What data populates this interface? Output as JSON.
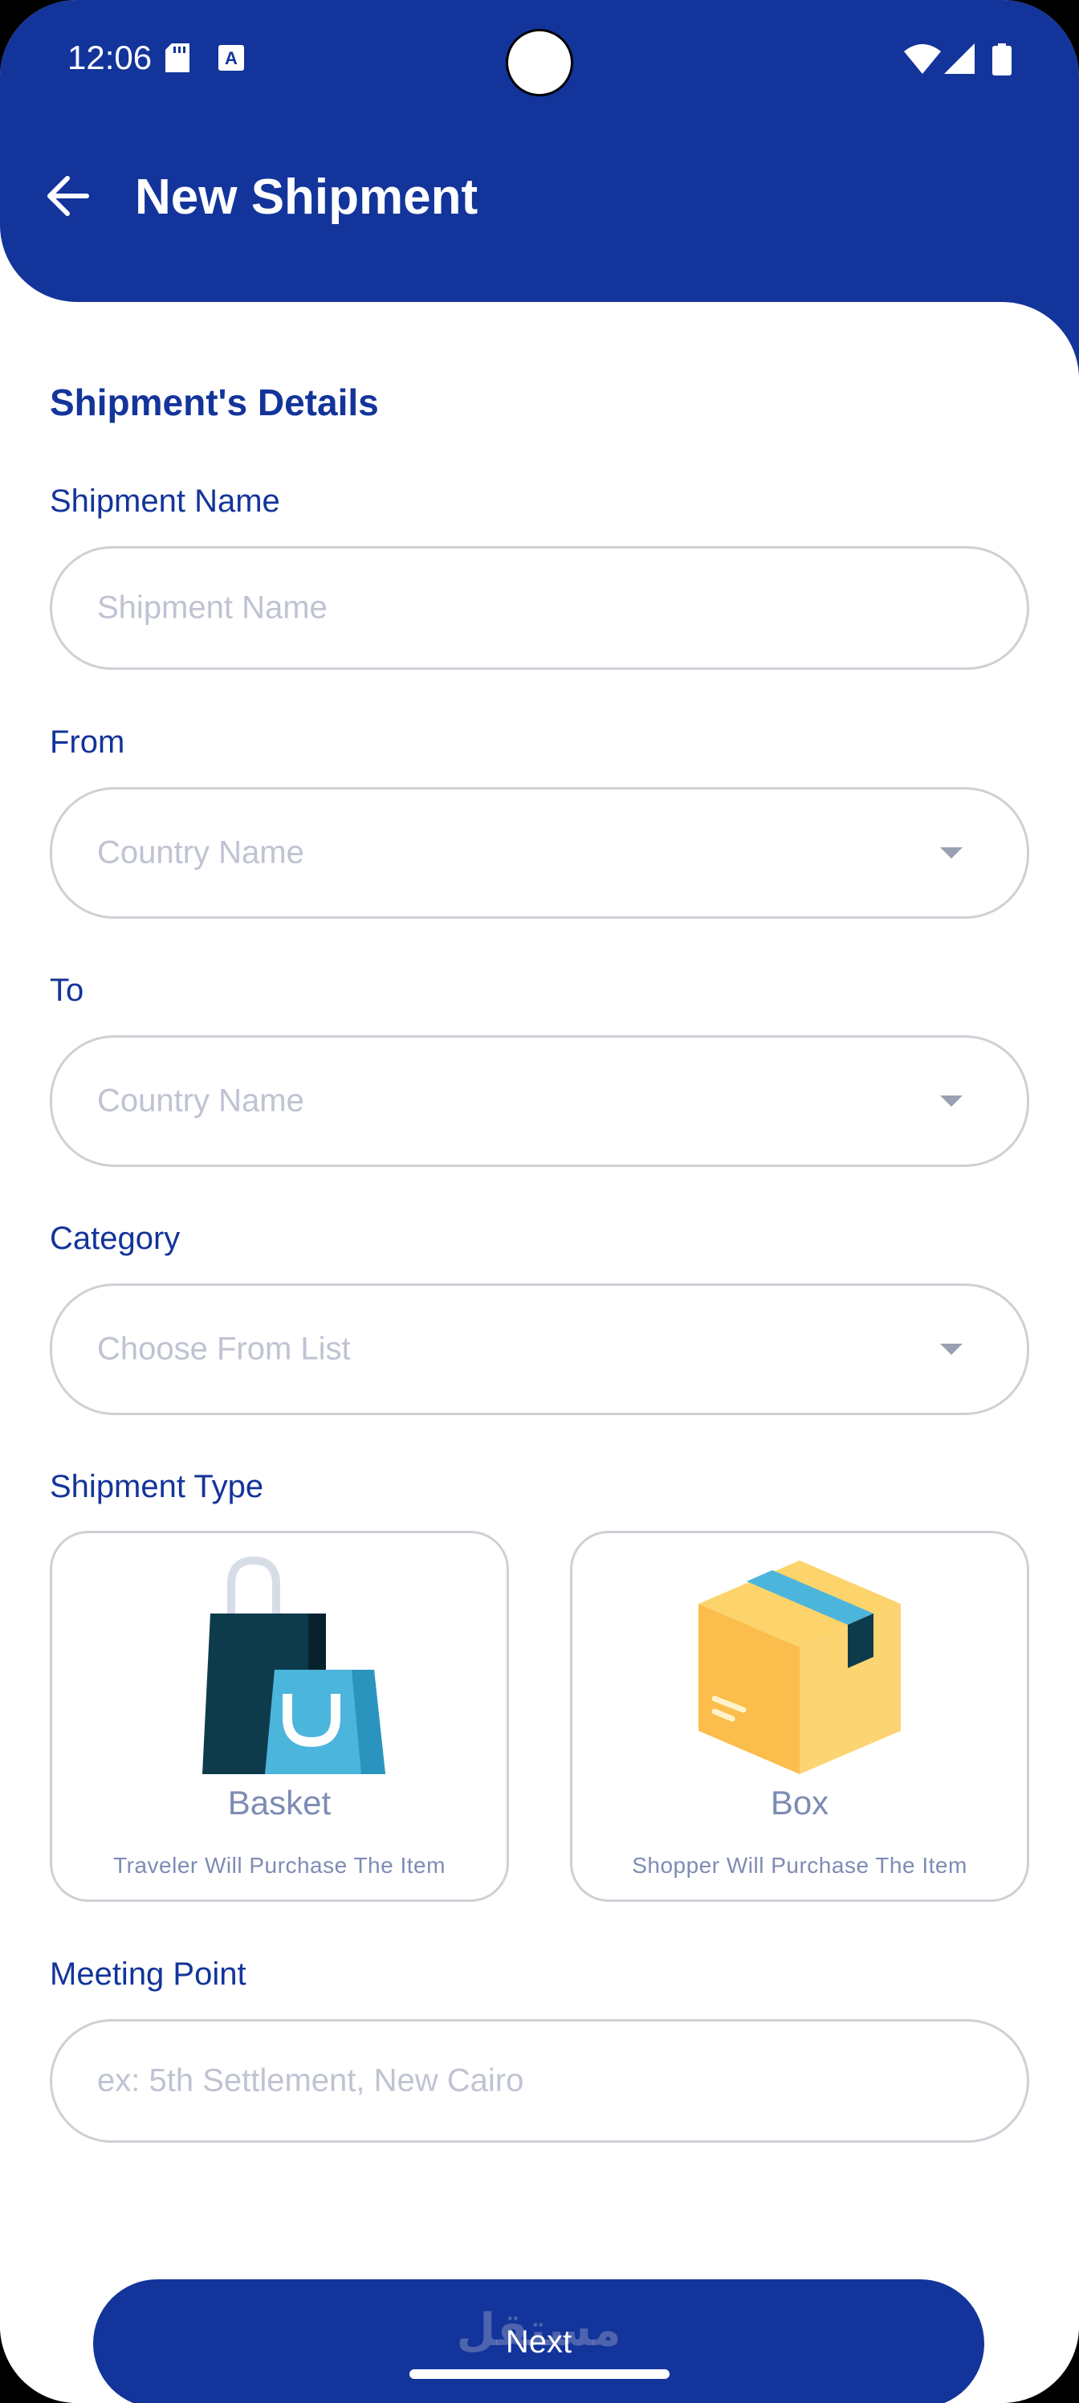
{
  "status_bar": {
    "time": "12:06",
    "left_icons": [
      "sd-card-icon",
      "text-a-icon"
    ],
    "right_icons": [
      "wifi-icon",
      "cell-signal-icon",
      "battery-icon"
    ]
  },
  "header": {
    "title": "New Shipment",
    "back_icon": "arrow-left-icon"
  },
  "form": {
    "section_title": "Shipment's Details",
    "shipment_name": {
      "label": "Shipment Name",
      "placeholder": "Shipment Name"
    },
    "from": {
      "label": "From",
      "placeholder": "Country Name"
    },
    "to": {
      "label": "To",
      "placeholder": "Country Name"
    },
    "category": {
      "label": "Category",
      "placeholder": "Choose From List"
    },
    "shipment_type": {
      "label": "Shipment Type",
      "options": [
        {
          "name": "Basket",
          "description": "Traveler Will Purchase The Item",
          "icon": "shopping-bags-icon"
        },
        {
          "name": "Box",
          "description": "Shopper Will Purchase The Item",
          "icon": "cardboard-box-icon"
        }
      ]
    },
    "meeting_point": {
      "label": "Meeting Point",
      "placeholder": "ex: 5th Settlement, New Cairo"
    }
  },
  "footer": {
    "next_label": "Next",
    "watermark": "مستقل"
  },
  "colors": {
    "primary": "#13349a",
    "placeholder": "#bfc3d2",
    "border": "#cfd0d6",
    "muted_text": "#7e8bb4"
  }
}
